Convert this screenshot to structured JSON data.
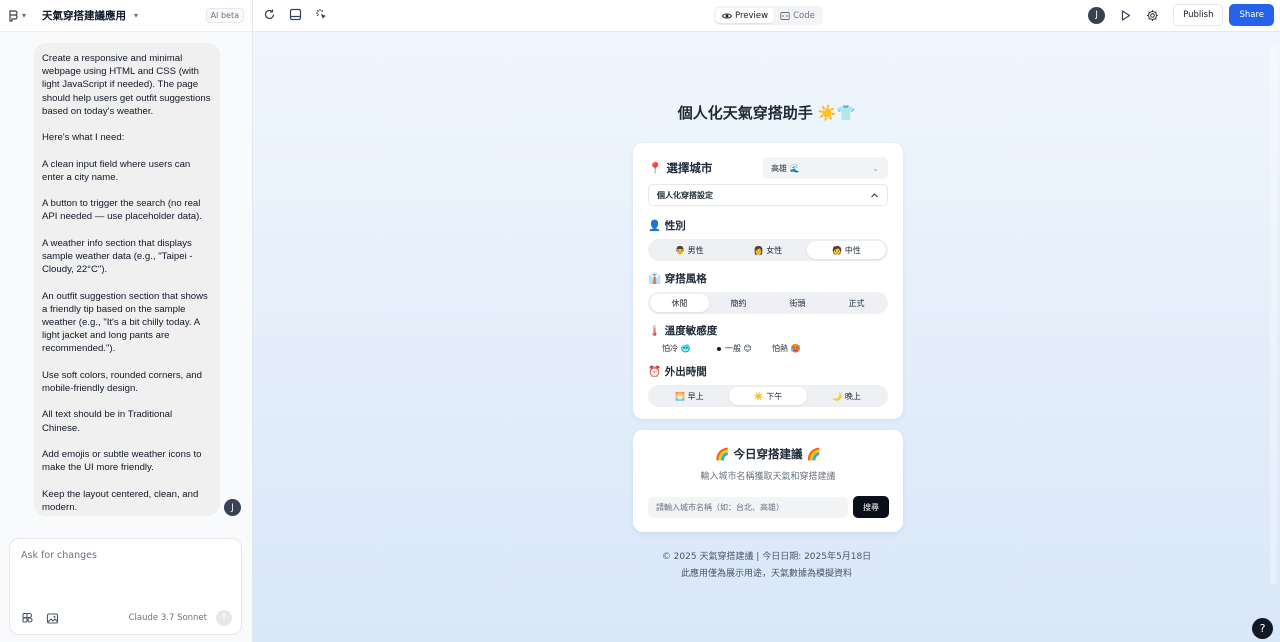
{
  "sidebar": {
    "app_title": "天氣穿搭建議應用",
    "badge": "AI beta",
    "message": [
      "Create a responsive and minimal webpage using HTML and CSS (with light JavaScript if needed). The page should help users get outfit suggestions based on today's weather.",
      "Here's what I need:",
      "A clean input field where users can enter a city name.",
      "A button to trigger the search (no real API needed — use placeholder data).",
      "A weather info section that displays sample weather data (e.g., \"Taipei - Cloudy, 22°C\").",
      "An outfit suggestion section that shows a friendly tip based on the sample weather (e.g., \"It's a bit chilly today. A light jacket and long pants are recommended.\").",
      "Use soft colors, rounded corners, and mobile-friendly design.",
      "All text should be in Traditional Chinese.",
      "Add emojis or subtle weather icons to make the UI more friendly.",
      "Keep the layout centered, clean, and modern."
    ],
    "user_initial": "J",
    "chat_placeholder": "Ask for changes",
    "model_name": "Claude 3.7 Sonnet",
    "icons": [
      "figma-icon",
      "image-icon",
      "send-icon"
    ]
  },
  "topbar": {
    "icons": [
      "refresh-icon",
      "layout-icon",
      "magic-select-icon"
    ],
    "preview_label": "Preview",
    "code_label": "Code",
    "user_initial": "J",
    "publish_label": "Publish",
    "share_label": "Share",
    "accent": "#2563eb"
  },
  "app": {
    "title": "個人化天氣穿搭助手 ☀️👕",
    "city_label": "📍 選擇城市",
    "city_value": "高雄 🌊",
    "accordion_label": "個人化穿搭設定",
    "gender": {
      "label": "👤 性別",
      "options": [
        "👨 男性",
        "👩 女性",
        "🧑 中性"
      ],
      "selected": 2
    },
    "style": {
      "label": "👔 穿搭風格",
      "options": [
        "休閒",
        "簡約",
        "街頭",
        "正式"
      ],
      "selected": 0
    },
    "temp": {
      "label": "🌡️ 溫度敏感度",
      "options": [
        "怕冷 🥶",
        "一般 😊",
        "怕熱 🥵"
      ],
      "selected": 1
    },
    "time": {
      "label": "⏰ 外出時間",
      "options": [
        "🌅 早上",
        "☀️ 下午",
        "🌙 晚上"
      ],
      "selected": 1
    },
    "result_title": "🌈 今日穿搭建議 🌈",
    "result_sub": "輸入城市名稱獲取天氣和穿搭建議",
    "input_placeholder": "請輸入城市名稱（如：台北、高雄）",
    "search_label": "搜尋",
    "footer1": "© 2025 天氣穿搭建議 | 今日日期: 2025年5月18日",
    "footer2": "此應用僅為展示用途，天氣數據為模擬資料",
    "help": "?"
  }
}
